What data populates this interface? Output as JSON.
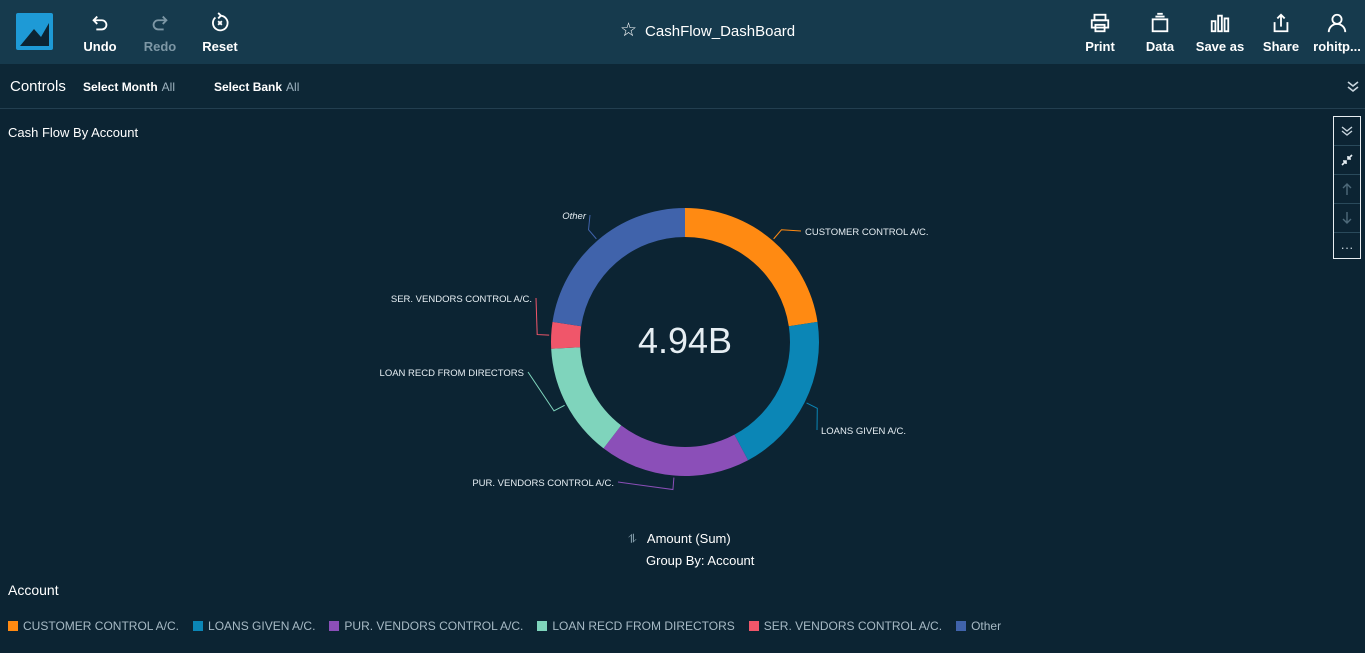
{
  "toolbar": {
    "undo_label": "Undo",
    "redo_label": "Redo",
    "reset_label": "Reset",
    "dashboard_title": "CashFlow_DashBoard",
    "print_label": "Print",
    "data_label": "Data",
    "save_as_label": "Save as",
    "share_label": "Share",
    "user_label": "rohitp..."
  },
  "controls": {
    "label": "Controls",
    "filters": [
      {
        "name": "Select Month",
        "value": "All"
      },
      {
        "name": "Select Bank",
        "value": "All"
      }
    ]
  },
  "visual": {
    "title": "Cash Flow By Account",
    "total": "4.94B",
    "measure": "Amount (Sum)",
    "group_by": "Group By: Account",
    "legend_title": "Account"
  },
  "colors": {
    "customer": "#ff8a12",
    "loans_given": "#0b86b6",
    "pur_vendors": "#8b4fb8",
    "loan_recd": "#7fd4bc",
    "ser_vendors": "#f0566a",
    "other": "#4063ab"
  },
  "chart_data": {
    "type": "pie",
    "donut": true,
    "categories": [
      "CUSTOMER CONTROL A/C.",
      "LOANS GIVEN A/C.",
      "PUR. VENDORS CONTROL A/C.",
      "LOAN RECD FROM DIRECTORS",
      "SER. VENDORS CONTROL A/C.",
      "Other"
    ],
    "values": [
      0.226,
      0.196,
      0.182,
      0.138,
      0.032,
      0.226
    ],
    "colors": [
      "#ff8a12",
      "#0b86b6",
      "#8b4fb8",
      "#7fd4bc",
      "#f0566a",
      "#4063ab"
    ],
    "total_label": "4.94B"
  }
}
